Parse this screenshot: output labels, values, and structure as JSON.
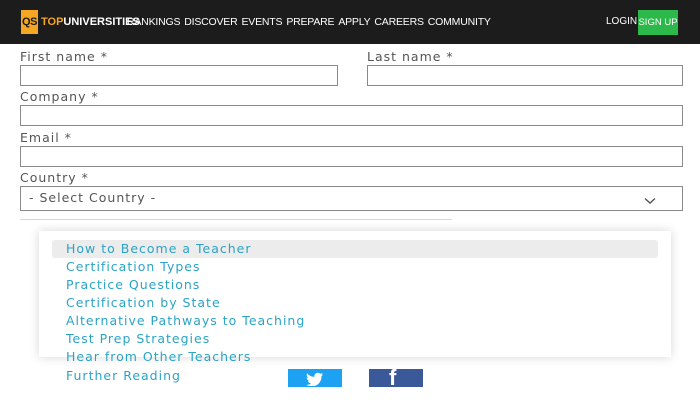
{
  "header": {
    "logo_mark": "QS",
    "logo_text_top": "TOP",
    "logo_text_rest": "UNIVERSITIES",
    "nav": [
      "RANKINGS",
      "DISCOVER",
      "EVENTS",
      "PREPARE",
      "APPLY",
      "CAREERS",
      "COMMUNITY"
    ],
    "login_label": "LOGIN",
    "signup_label": "SIGN UP",
    "colors": {
      "bar": "#1c1c1c",
      "accent": "#f5a623",
      "signup": "#2db84b"
    }
  },
  "form": {
    "first_name_label": "First name *",
    "last_name_label": "Last name *",
    "company_label": "Company *",
    "email_label": "Email *",
    "country_label": "Country *",
    "country_value": "- Select Country -"
  },
  "menu": {
    "items": [
      "How to Become a Teacher",
      "Certification Types",
      "Practice Questions",
      "Certification by State",
      "Alternative Pathways to Teaching",
      "Test Prep Strategies",
      "Hear from Other Teachers",
      "Further Reading"
    ],
    "link_color": "#2ba3c6",
    "highlight_color": "#ececec"
  },
  "social": {
    "twitter_icon": "twitter-icon",
    "facebook_icon": "facebook-icon",
    "facebook_glyph": "f",
    "twitter_color": "#1da1f2",
    "facebook_color": "#3b5998"
  }
}
